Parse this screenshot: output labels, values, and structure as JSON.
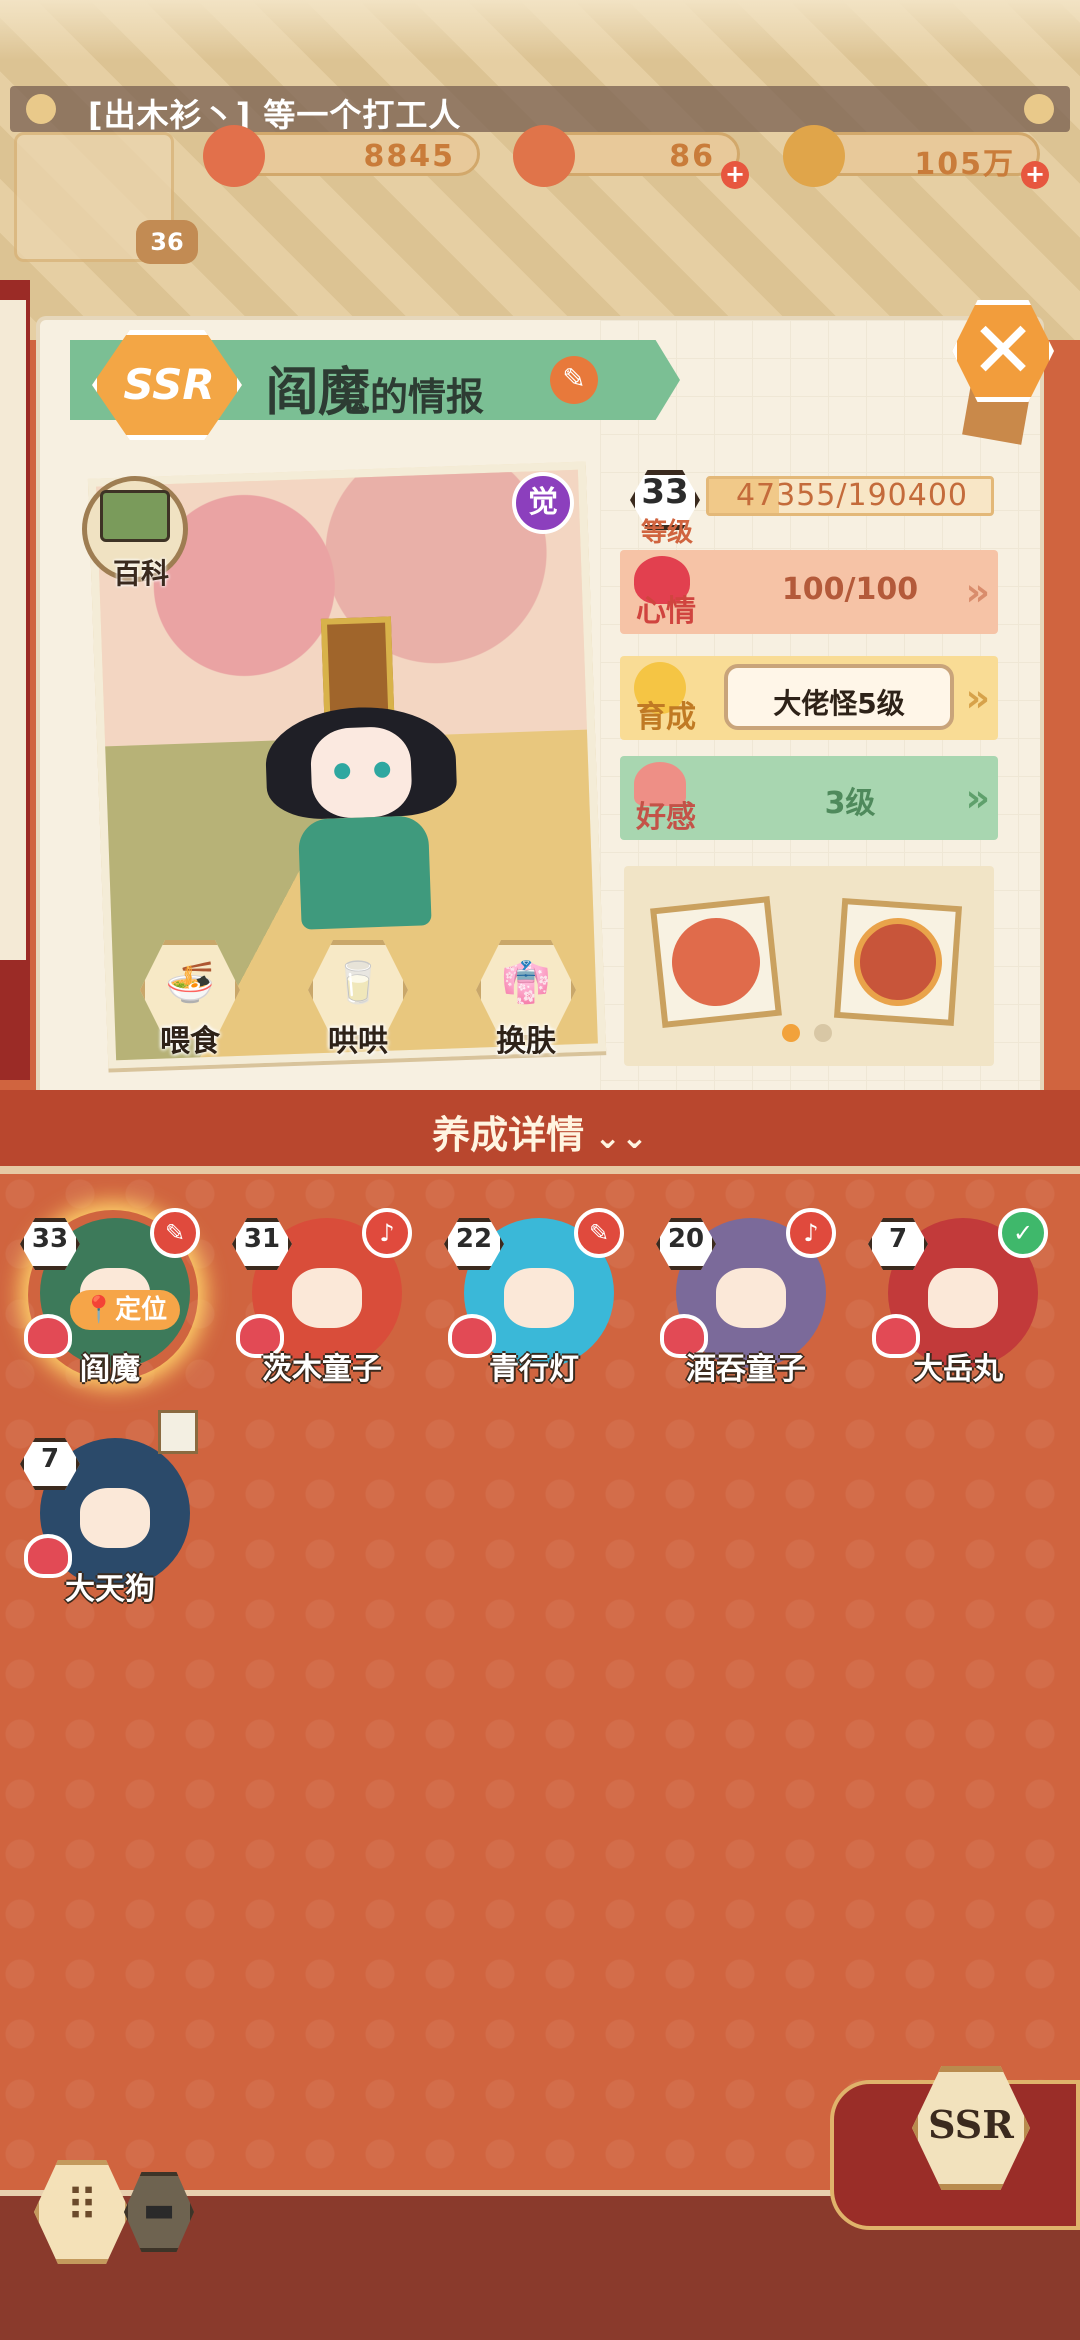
{
  "header": {
    "title": "[出木衫丶] 等一个打工人",
    "resources": [
      {
        "name": "coin-heart",
        "value": "8845",
        "color": "#e2704b"
      },
      {
        "name": "crystal",
        "value": "86",
        "color": "#e0744a"
      },
      {
        "name": "gold-coin",
        "value": "105万",
        "color": "#e0a54a"
      }
    ],
    "player_level": "36"
  },
  "info": {
    "rarity": "SSR",
    "name": "阎魔",
    "title_suffix": "的情报",
    "awaken_badge": "觉",
    "wiki_label": "百科",
    "actions": {
      "feed": "喂食",
      "coax": "哄哄",
      "skin": "换肤"
    }
  },
  "stats": {
    "level": "33",
    "level_label": "等级",
    "exp_text": "47355/190400",
    "exp_fraction": 0.249,
    "mood_label": "心情",
    "mood_value": "100/100",
    "nurture_label": "育成",
    "nurture_value": "大佬怪5级",
    "affinity_label": "好感",
    "affinity_value": "3级"
  },
  "detail": {
    "label": "养成详情",
    "chevron": "»"
  },
  "roster": [
    {
      "name": "阎魔",
      "level": "33",
      "selected": true,
      "locate": "定位",
      "tag": "",
      "color": "#3d7a5a"
    },
    {
      "name": "茨木童子",
      "level": "31",
      "tag": "",
      "color": "#d94d3a"
    },
    {
      "name": "青行灯",
      "level": "22",
      "tag": "",
      "color": "#3ab8d8"
    },
    {
      "name": "酒吞童子",
      "level": "20",
      "tag": "",
      "color": "#7b6a9a"
    },
    {
      "name": "大岳丸",
      "level": "7",
      "tag": "✓",
      "color": "#c23a3a"
    },
    {
      "name": "大天狗",
      "level": "7",
      "tag": "",
      "color": "#2b4a6a"
    }
  ],
  "footer": {
    "ssr_tab": "SSR"
  },
  "colors": {
    "accent": "#d0643f",
    "mood_row": "#f6c3a6",
    "nurture_row": "#f9dc95",
    "affinity_row": "#a8d6b0",
    "ribbon": "#7bbf94"
  }
}
